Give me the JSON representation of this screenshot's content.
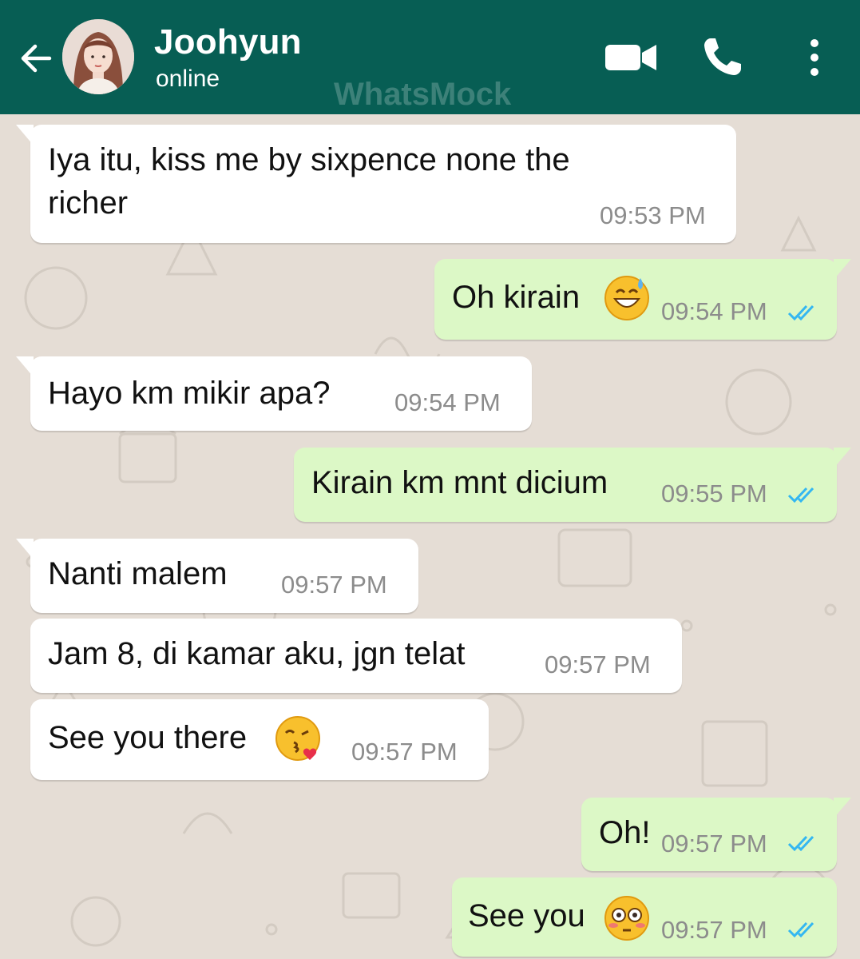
{
  "header": {
    "contact_name": "Joohyun",
    "status": "online",
    "watermark": "WhatsMock",
    "colors": {
      "bar": "#075e54"
    },
    "icons": [
      "back-arrow-icon",
      "video-call-icon",
      "phone-icon",
      "more-options-icon"
    ]
  },
  "chat": {
    "colors": {
      "incoming": "#ffffff",
      "outgoing": "#dcf8c6",
      "read_ticks": "#34b7f1",
      "wallpaper": "#e5ddd5"
    },
    "messages": [
      {
        "direction": "incoming",
        "text_line1": "Iya itu, kiss me by sixpence none the",
        "text_line2": "richer",
        "time": "09:53 PM"
      },
      {
        "direction": "outgoing",
        "text": "Oh kirain",
        "emoji": "grinning-sweat-emoji",
        "time": "09:54 PM",
        "status": "read"
      },
      {
        "direction": "incoming",
        "text": "Hayo km mikir apa?",
        "time": "09:54 PM"
      },
      {
        "direction": "outgoing",
        "text": "Kirain km mnt dicium",
        "time": "09:55 PM",
        "status": "read"
      },
      {
        "direction": "incoming",
        "text": "Nanti malem",
        "time": "09:57 PM"
      },
      {
        "direction": "incoming",
        "text": "Jam 8, di kamar aku, jgn telat",
        "time": "09:57 PM"
      },
      {
        "direction": "incoming",
        "text": "See you there",
        "emoji": "face-blowing-kiss-emoji",
        "time": "09:57 PM"
      },
      {
        "direction": "outgoing",
        "text": "Oh!",
        "time": "09:57 PM",
        "status": "read"
      },
      {
        "direction": "outgoing",
        "text": "See you",
        "emoji": "flushed-face-emoji",
        "time": "09:57 PM",
        "status": "read"
      }
    ]
  }
}
